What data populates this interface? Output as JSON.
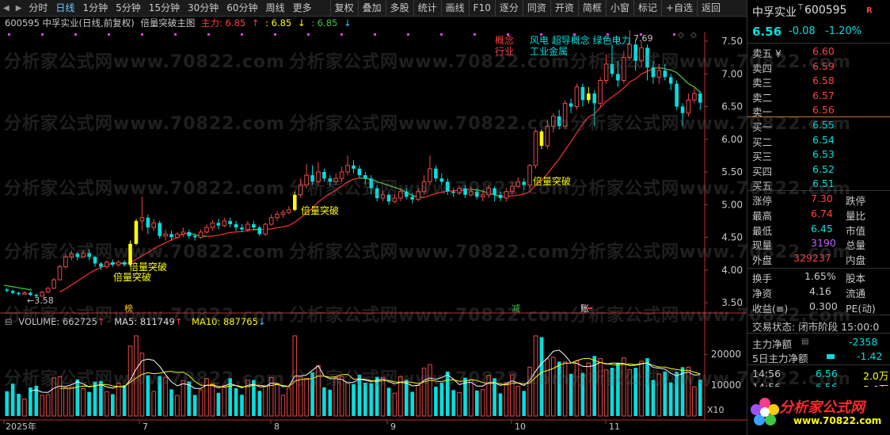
{
  "toolbar": {
    "periods": [
      "分时",
      "日线",
      "1分钟",
      "5分钟",
      "15分钟",
      "30分钟",
      "60分钟",
      "周线",
      "更多"
    ],
    "active_period": "日线",
    "tools": [
      "复权",
      "叠加",
      "多股",
      "统计",
      "画线",
      "F10",
      "逐分",
      "同资",
      "开资",
      "简框",
      "小窗",
      "标记",
      "+自选",
      "返回"
    ]
  },
  "info": {
    "code_name": "600595 中孚实业(日线,前复权)",
    "indicator": "倍量突破主图",
    "zhuli": "主力: 6.85",
    "v2": ": 6.85",
    "v3": ": 6.85"
  },
  "chart_data": {
    "type": "candlestick",
    "y_ticks": [
      "7.50",
      "7.00",
      "6.50",
      "6.00",
      "5.50",
      "5.00",
      "4.50",
      "4.00",
      "3.50"
    ],
    "ylim": [
      3.5,
      7.5
    ],
    "x_labels": [
      "2025年",
      "7",
      "8",
      "9",
      "10",
      "11"
    ],
    "annotations": {
      "low_label": "←3.58",
      "high_label": "7.69",
      "breakout_label": "倍量突破",
      "concept_tags": [
        "概念",
        "行业"
      ],
      "concept_values": [
        "风电 超导概念 绿色电力",
        "工业金属"
      ],
      "event_markers": [
        "榜",
        "减",
        "账"
      ]
    },
    "candles": [
      [
        3.7,
        3.68,
        3.73,
        3.66
      ],
      [
        3.68,
        3.65,
        3.7,
        3.63
      ],
      [
        3.65,
        3.63,
        3.67,
        3.61
      ],
      [
        3.63,
        3.65,
        3.68,
        3.62
      ],
      [
        3.65,
        3.62,
        3.67,
        3.6
      ],
      [
        3.62,
        3.6,
        3.64,
        3.58
      ],
      [
        3.6,
        3.66,
        3.68,
        3.59
      ],
      [
        3.66,
        3.72,
        3.74,
        3.65
      ],
      [
        3.72,
        3.85,
        3.88,
        3.71
      ],
      [
        3.85,
        4.05,
        4.08,
        3.84
      ],
      [
        4.05,
        4.2,
        4.25,
        4.02
      ],
      [
        4.2,
        4.25,
        4.3,
        4.15
      ],
      [
        4.25,
        4.2,
        4.28,
        4.15
      ],
      [
        4.2,
        4.26,
        4.3,
        4.18
      ],
      [
        4.26,
        4.2,
        4.32,
        4.15
      ],
      [
        4.2,
        4.1,
        4.22,
        4.05
      ],
      [
        4.1,
        4.05,
        4.12,
        4.0
      ],
      [
        4.05,
        4.12,
        4.15,
        4.02
      ],
      [
        4.12,
        4.08,
        4.16,
        4.05
      ],
      [
        4.08,
        4.12,
        4.15,
        4.05
      ],
      [
        4.12,
        4.08,
        4.15,
        4.05
      ],
      [
        4.08,
        4.4,
        4.45,
        4.07
      ],
      [
        4.4,
        4.75,
        4.78,
        4.38
      ],
      [
        4.75,
        4.8,
        5.12,
        4.6
      ],
      [
        4.8,
        4.65,
        4.85,
        4.55
      ],
      [
        4.65,
        4.72,
        4.78,
        4.6
      ],
      [
        4.72,
        4.52,
        4.75,
        4.48
      ],
      [
        4.52,
        4.55,
        4.62,
        4.45
      ],
      [
        4.55,
        4.5,
        4.6,
        4.45
      ],
      [
        4.5,
        4.55,
        4.58,
        4.48
      ],
      [
        4.55,
        4.58,
        4.65,
        4.5
      ],
      [
        4.58,
        4.52,
        4.62,
        4.48
      ],
      [
        4.52,
        4.5,
        4.56,
        4.45
      ],
      [
        4.5,
        4.58,
        4.62,
        4.48
      ],
      [
        4.58,
        4.65,
        4.7,
        4.55
      ],
      [
        4.65,
        4.72,
        4.76,
        4.6
      ],
      [
        4.72,
        4.68,
        4.78,
        4.62
      ],
      [
        4.68,
        4.75,
        4.8,
        4.65
      ],
      [
        4.75,
        4.7,
        4.8,
        4.65
      ],
      [
        4.7,
        4.65,
        4.75,
        4.6
      ],
      [
        4.65,
        4.62,
        4.7,
        4.58
      ],
      [
        4.62,
        4.7,
        4.75,
        4.58
      ],
      [
        4.7,
        4.65,
        4.75,
        4.6
      ],
      [
        4.65,
        4.55,
        4.68,
        4.52
      ],
      [
        4.55,
        4.7,
        4.72,
        4.52
      ],
      [
        4.7,
        4.8,
        4.85,
        4.68
      ],
      [
        4.8,
        4.85,
        4.9,
        4.75
      ],
      [
        4.85,
        4.88,
        4.92,
        4.8
      ],
      [
        4.88,
        4.92,
        4.98,
        4.85
      ],
      [
        4.92,
        5.15,
        5.2,
        4.9
      ],
      [
        5.15,
        5.3,
        5.4,
        5.1
      ],
      [
        5.3,
        5.45,
        5.62,
        5.25
      ],
      [
        5.45,
        5.35,
        5.6,
        5.3
      ],
      [
        5.35,
        5.5,
        5.65,
        5.3
      ],
      [
        5.5,
        5.4,
        5.55,
        5.35
      ],
      [
        5.4,
        5.35,
        5.45,
        5.28
      ],
      [
        5.35,
        5.4,
        5.48,
        5.3
      ],
      [
        5.4,
        5.5,
        5.58,
        5.35
      ],
      [
        5.5,
        5.6,
        5.75,
        5.45
      ],
      [
        5.6,
        5.55,
        5.68,
        5.48
      ],
      [
        5.55,
        5.45,
        5.6,
        5.4
      ],
      [
        5.45,
        5.4,
        5.5,
        5.3
      ],
      [
        5.4,
        5.25,
        5.45,
        5.15
      ],
      [
        5.25,
        5.1,
        5.3,
        5.05
      ],
      [
        5.1,
        5.15,
        5.22,
        5.05
      ],
      [
        5.15,
        5.05,
        5.18,
        5.0
      ],
      [
        5.05,
        5.1,
        5.15,
        5.02
      ],
      [
        5.1,
        5.2,
        5.25,
        5.05
      ],
      [
        5.2,
        5.12,
        5.25,
        5.08
      ],
      [
        5.12,
        5.08,
        5.18,
        5.02
      ],
      [
        5.08,
        5.2,
        5.25,
        5.05
      ],
      [
        5.2,
        5.35,
        5.45,
        5.15
      ],
      [
        5.35,
        5.55,
        5.75,
        5.3
      ],
      [
        5.55,
        5.4,
        5.6,
        5.35
      ],
      [
        5.4,
        5.35,
        5.48,
        5.3
      ],
      [
        5.35,
        5.2,
        5.4,
        5.15
      ],
      [
        5.2,
        5.18,
        5.25,
        5.12
      ],
      [
        5.18,
        5.25,
        5.3,
        5.15
      ],
      [
        5.25,
        5.15,
        5.3,
        5.1
      ],
      [
        5.15,
        5.2,
        5.28,
        5.12
      ],
      [
        5.2,
        5.12,
        5.25,
        5.08
      ],
      [
        5.12,
        5.15,
        5.2,
        5.05
      ],
      [
        5.15,
        5.25,
        5.3,
        5.1
      ],
      [
        5.25,
        5.15,
        5.28,
        5.05
      ],
      [
        5.15,
        5.1,
        5.2,
        5.05
      ],
      [
        5.1,
        5.2,
        5.25,
        5.05
      ],
      [
        5.2,
        5.28,
        5.35,
        5.15
      ],
      [
        5.28,
        5.35,
        5.42,
        5.25
      ],
      [
        5.35,
        5.3,
        5.4,
        5.22
      ],
      [
        5.3,
        5.6,
        5.62,
        5.25
      ],
      [
        5.6,
        6.12,
        6.15,
        5.55
      ],
      [
        6.12,
        5.9,
        6.15,
        5.85
      ],
      [
        5.9,
        6.2,
        6.3,
        5.85
      ],
      [
        6.2,
        6.35,
        6.4,
        6.1
      ],
      [
        6.35,
        6.2,
        6.45,
        6.15
      ],
      [
        6.2,
        6.55,
        6.6,
        6.15
      ],
      [
        6.55,
        6.5,
        6.62,
        6.4
      ],
      [
        6.5,
        6.8,
        6.85,
        6.45
      ],
      [
        6.8,
        6.6,
        6.85,
        6.5
      ],
      [
        6.6,
        6.7,
        6.8,
        6.55
      ],
      [
        6.7,
        6.55,
        6.75,
        6.2
      ],
      [
        6.55,
        6.9,
        6.95,
        6.5
      ],
      [
        6.9,
        7.15,
        7.3,
        6.85
      ],
      [
        7.15,
        7.0,
        7.45,
        6.95
      ],
      [
        7.0,
        6.9,
        7.2,
        6.8
      ],
      [
        6.9,
        7.25,
        7.35,
        6.85
      ],
      [
        7.25,
        7.45,
        7.69,
        7.2
      ],
      [
        7.45,
        7.2,
        7.5,
        7.05
      ],
      [
        7.2,
        7.4,
        7.5,
        7.1
      ],
      [
        7.4,
        7.1,
        7.45,
        6.9
      ],
      [
        7.1,
        6.95,
        7.2,
        6.85
      ],
      [
        6.95,
        7.05,
        7.15,
        6.85
      ],
      [
        7.05,
        6.95,
        7.15,
        6.9
      ],
      [
        6.95,
        6.85,
        7.0,
        6.75
      ],
      [
        6.85,
        6.5,
        6.9,
        6.45
      ],
      [
        6.5,
        6.4,
        6.55,
        6.2
      ],
      [
        6.4,
        6.6,
        6.7,
        6.35
      ],
      [
        6.6,
        6.7,
        6.78,
        6.55
      ],
      [
        6.7,
        6.56,
        6.74,
        6.45
      ]
    ],
    "breakout_index": [
      21,
      22,
      49,
      91,
      99
    ],
    "volume": {
      "label": "VOLUME: 662725",
      "ma5": "MA5: 811749",
      "ma10": "MA10: 887765",
      "y_ticks": [
        "20000",
        "10000"
      ],
      "unit": "X10",
      "ylim": [
        0,
        27000
      ]
    }
  },
  "quote": {
    "name": "中孚实业",
    "code": "600595",
    "price": "6.56",
    "change": "-0.08",
    "change_pct": "-1.20%",
    "asks": [
      [
        "卖五 ¥",
        "6.60"
      ],
      [
        "卖四",
        "6.59"
      ],
      [
        "卖三",
        "6.58"
      ],
      [
        "卖二",
        "6.57"
      ],
      [
        "卖一",
        "6.56"
      ]
    ],
    "bids": [
      [
        "买一",
        "6.55"
      ],
      [
        "买二",
        "6.54"
      ],
      [
        "买三",
        "6.53"
      ],
      [
        "买四",
        "6.52"
      ],
      [
        "买五",
        "6.51"
      ]
    ],
    "stats": [
      [
        "涨停",
        "7.30",
        "跌停"
      ],
      [
        "最高",
        "6.74",
        "量比"
      ],
      [
        "最低",
        "6.45",
        "市值"
      ],
      [
        "现量",
        "3190",
        "总量"
      ],
      [
        "外盘",
        "329237",
        "内盘"
      ]
    ],
    "stats2": [
      [
        "换手",
        "1.65%",
        "股本"
      ],
      [
        "净资",
        "4.16",
        "流通"
      ],
      [
        "收益(≡)",
        "0.300",
        "PE(动)"
      ]
    ],
    "status": "交易状态: 闭市阶段 15:00:0",
    "flow1_label": "主力净额",
    "flow1_value": "-2358",
    "flow2_label": "5日主力净额",
    "flow2_value": "-1.42",
    "ticks": [
      [
        "14:56",
        "6.56",
        "2.0万"
      ],
      [
        "14:56",
        "6.56",
        "5.6万"
      ]
    ],
    "logo_text": "分析家公式网",
    "logo_url": "www.70822.com"
  },
  "colors": {
    "up": "#f04848",
    "down": "#00e0e0",
    "breakout": "#ffff00",
    "ma_red": "#ff3030",
    "ma_green": "#3cc83c"
  }
}
